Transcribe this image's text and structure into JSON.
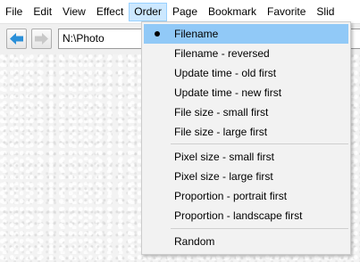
{
  "menubar": {
    "items": [
      {
        "label": "File"
      },
      {
        "label": "Edit"
      },
      {
        "label": "View"
      },
      {
        "label": "Effect"
      },
      {
        "label": "Order",
        "active": true
      },
      {
        "label": "Page"
      },
      {
        "label": "Bookmark"
      },
      {
        "label": "Favorite"
      },
      {
        "label": "Slid"
      }
    ]
  },
  "toolbar": {
    "back_icon": "arrow-left-icon",
    "forward_icon": "arrow-right-icon",
    "path_value": "N:\\Photo"
  },
  "colors": {
    "accent": "#91c9f7",
    "menu_active_bg": "#cce8ff",
    "back_arrow": "#2a8fd8",
    "forward_arrow_disabled": "#c8c8c8"
  },
  "order_menu": {
    "items": [
      {
        "label": "Filename",
        "checked": true
      },
      {
        "label": "Filename - reversed"
      },
      {
        "label": "Update time - old first"
      },
      {
        "label": "Update time - new first"
      },
      {
        "label": "File size - small first"
      },
      {
        "label": "File size - large first"
      },
      {
        "label": "Pixel size - small first"
      },
      {
        "label": "Pixel size - large first"
      },
      {
        "label": "Proportion - portrait first"
      },
      {
        "label": "Proportion - landscape first"
      },
      {
        "label": "Random"
      }
    ]
  }
}
